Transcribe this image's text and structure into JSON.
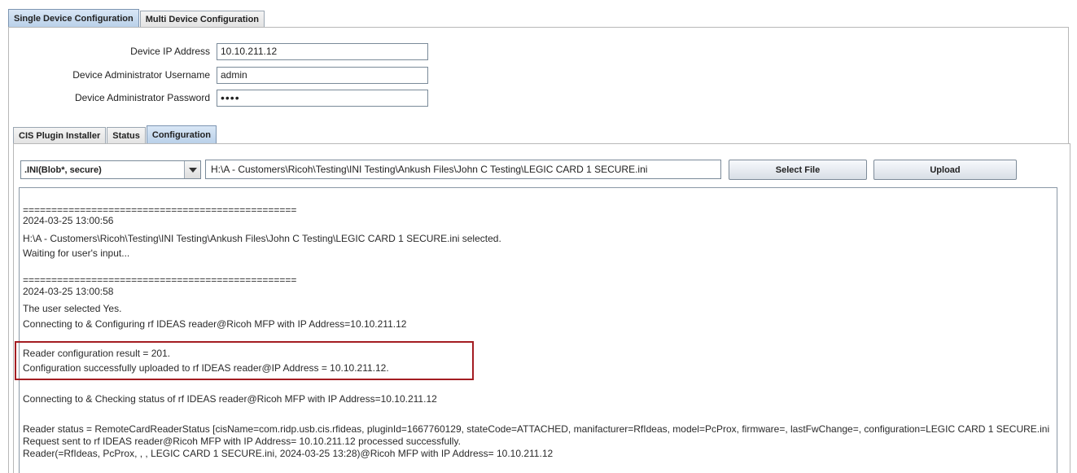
{
  "top_tabs": [
    {
      "label": "Single Device Configuration",
      "selected": true
    },
    {
      "label": "Multi Device Configuration",
      "selected": false
    }
  ],
  "form": {
    "ip_label": "Device IP Address",
    "ip_value": "10.10.211.12",
    "user_label": "Device Administrator Username",
    "user_value": "admin",
    "pass_label": "Device Administrator Password",
    "pass_value": "••••"
  },
  "inner_tabs": [
    {
      "label": "CIS Plugin Installer",
      "selected": false
    },
    {
      "label": "Status",
      "selected": false
    },
    {
      "label": "Configuration",
      "selected": true
    }
  ],
  "toolbar": {
    "combo_value": ".INI(Blob*, secure)",
    "file_path": "H:\\A - Customers\\Ricoh\\Testing\\INI Testing\\Ankush Files\\John C Testing\\LEGIC CARD 1 SECURE.ini",
    "select_file_label": "Select File",
    "upload_label": "Upload"
  },
  "log": {
    "lines": [
      "================================================",
      "2024-03-25 13:00:56",
      "H:\\A - Customers\\Ricoh\\Testing\\INI Testing\\Ankush Files\\John C Testing\\LEGIC CARD 1 SECURE.ini selected.",
      "Waiting for user's input...",
      "================================================",
      "2024-03-25 13:00:58",
      "The user selected Yes.",
      "Connecting to & Configuring rf IDEAS reader@Ricoh MFP with IP Address=10.10.211.12",
      "Reader configuration result = 201.",
      "Configuration successfully uploaded to rf IDEAS reader@IP Address = 10.10.211.12.",
      "Connecting to & Checking status of rf IDEAS reader@Ricoh MFP with IP Address=10.10.211.12",
      "Reader status = RemoteCardReaderStatus [cisName=com.ridp.usb.cis.rfideas, pluginId=1667760129, stateCode=ATTACHED, manifacturer=RfIdeas, model=PcProx, firmware=, lastFwChange=, configuration=LEGIC CARD 1 SECURE.ini",
      "Request sent to rf IDEAS reader@Ricoh MFP with IP Address= 10.10.211.12 processed successfully.",
      "Reader(=RfIdeas, PcProx, , , LEGIC CARD 1 SECURE.ini, 2024-03-25 13:28)@Ricoh MFP with IP Address= 10.10.211.12"
    ]
  },
  "colors": {
    "highlight_border": "#a41d22",
    "selected_tab": "#c5d9ef"
  }
}
